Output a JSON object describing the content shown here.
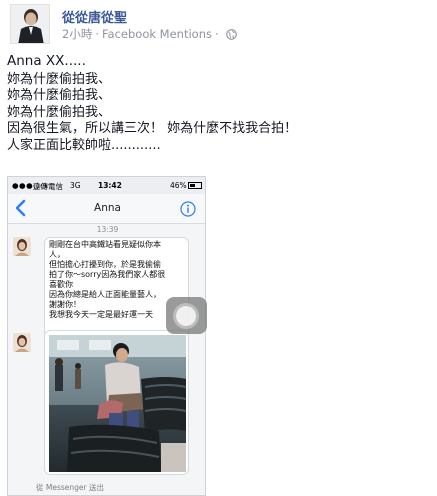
{
  "post": {
    "author": "從從唐從聖",
    "time": "2小時",
    "separator": "·",
    "via": "Facebook Mentions",
    "privacy_icon": "globe-icon",
    "lines": [
      "Anna XX.....",
      "妳為什麼偷拍我、",
      "妳為什麼偷拍我、",
      "妳為什麼偷拍我、",
      "因為很生氣，所以講三次！  妳為什麼不找我合拍！",
      "人家正面比較帥啦............"
    ]
  },
  "phone": {
    "status_bar": {
      "signal": "●●●○○",
      "carrier": "遠傳電信",
      "network": "3G",
      "time": "13:42",
      "battery": "46%"
    },
    "nav": {
      "back_icon": "chevron-left-icon",
      "title": "Anna",
      "info_icon": "info-icon"
    },
    "timestamp": "13:39",
    "message_lines": [
      "剛剛在台中高鐵站看見疑似你本",
      "人，",
      "但怕擔心打擾到你，於是我偷偷",
      "拍了你～sorry因為我們家人都很",
      "喜歡你",
      "因為你總是給人正面能量藝人，",
      "謝謝你！",
      "我想我今天一定是最好運一天"
    ],
    "footer": "從 Messenger 送出"
  },
  "colors": {
    "link": "#3b5998",
    "meta": "#90949c",
    "ios_blue": "#2d7cf6"
  }
}
